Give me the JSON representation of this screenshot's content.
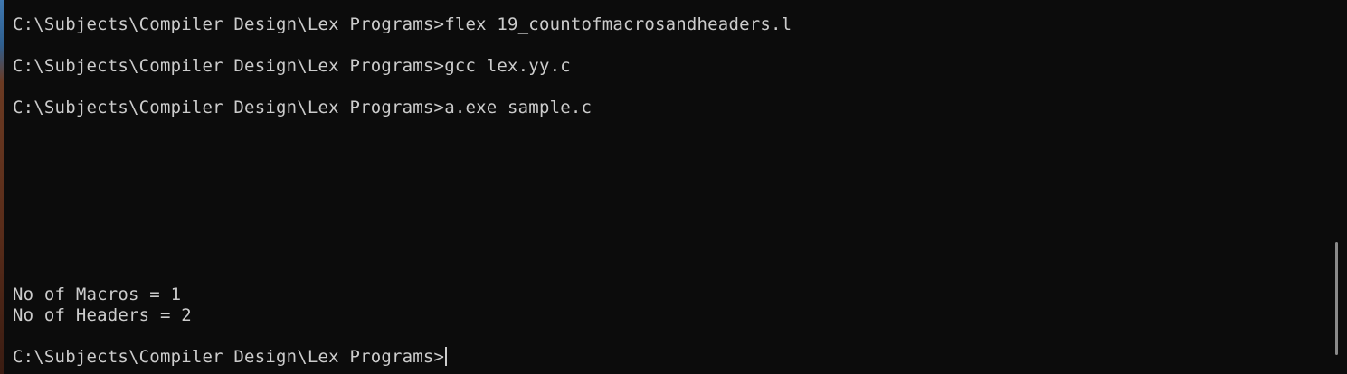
{
  "terminal": {
    "lines": [
      "C:\\Subjects\\Compiler Design\\Lex Programs>flex 19_countofmacrosandheaders.l",
      "C:\\Subjects\\Compiler Design\\Lex Programs>gcc lex.yy.c",
      "C:\\Subjects\\Compiler Design\\Lex Programs>a.exe sample.c",
      "No of Macros = 1",
      "No of Headers = 2",
      "C:\\Subjects\\Compiler Design\\Lex Programs>"
    ]
  }
}
